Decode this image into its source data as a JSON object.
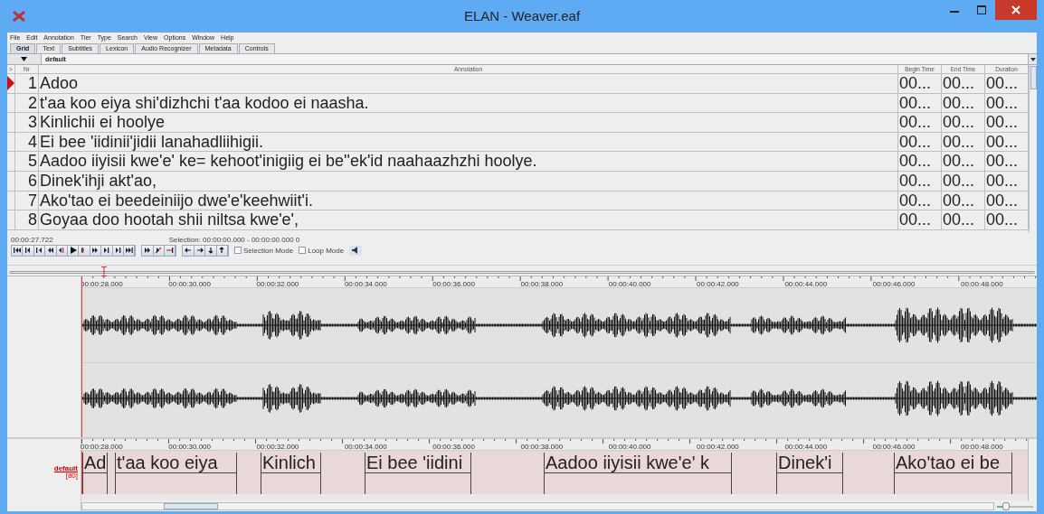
{
  "window": {
    "title": "ELAN - Weaver.eaf"
  },
  "menu": [
    "File",
    "Edit",
    "Annotation",
    "Tier",
    "Type",
    "Search",
    "View",
    "Options",
    "Window",
    "Help"
  ],
  "tabs": [
    {
      "label": "Grid",
      "selected": true
    },
    {
      "label": "Text",
      "selected": false
    },
    {
      "label": "Subtitles",
      "selected": false
    },
    {
      "label": "Lexicon",
      "selected": false
    },
    {
      "label": "Audio Recognizer",
      "selected": false
    },
    {
      "label": "Metadata",
      "selected": false
    },
    {
      "label": "Controls",
      "selected": false
    }
  ],
  "tier_selector": {
    "value": "default"
  },
  "table": {
    "columns": [
      ">",
      "Nr",
      "Annotation",
      "Begin Time",
      "End Time",
      "Duration"
    ],
    "rows": [
      {
        "nr": "1",
        "annotation": "Adoo",
        "begin": "00...",
        "end": "00...",
        "duration": "00...",
        "current": true
      },
      {
        "nr": "2",
        "annotation": "t'aa koo eiya shi'dizhchi t'aa kodoo ei naasha.",
        "begin": "00...",
        "end": "00...",
        "duration": "00...",
        "current": false
      },
      {
        "nr": "3",
        "annotation": "Kinlichii ei hoolye",
        "begin": "00...",
        "end": "00...",
        "duration": "00...",
        "current": false
      },
      {
        "nr": "4",
        "annotation": "Ei bee 'iidinii'jidii lanahadliihigii.",
        "begin": "00...",
        "end": "00...",
        "duration": "00...",
        "current": false
      },
      {
        "nr": "5",
        "annotation": "Aadoo iiyisii kwe'e' ke= kehoot'inigiig ei be''ek'id naahaazhzhi hoolye.",
        "begin": "00...",
        "end": "00...",
        "duration": "00...",
        "current": false
      },
      {
        "nr": "6",
        "annotation": "Dinek'ihji akt'ao,",
        "begin": "00...",
        "end": "00...",
        "duration": "00...",
        "current": false
      },
      {
        "nr": "7",
        "annotation": "Ako'tao ei beedeiniijo dwe'e'keehwiit'i.",
        "begin": "00...",
        "end": "00...",
        "duration": "00...",
        "current": false
      },
      {
        "nr": "8",
        "annotation": "Goyaa doo hootah shii niltsa kwe'e',",
        "begin": "00...",
        "end": "00...",
        "duration": "00...",
        "current": false
      }
    ]
  },
  "media": {
    "time": "00:00:27.722",
    "selection": "Selection: 00:00:00.000 - 00:00:00.000  0",
    "options": [
      {
        "label": "Selection Mode",
        "checked": false
      },
      {
        "label": "Loop Mode",
        "checked": false
      }
    ]
  },
  "waveform": {
    "ruler": [
      "00:00:28.000",
      "00:00:30.000",
      "00:00:32.000",
      "00:00:34.000",
      "00:00:36.000",
      "00:00:38.000",
      "00:00:40.000",
      "00:00:42.000",
      "00:00:44.000",
      "00:00:46.000",
      "00:00:48.000"
    ]
  },
  "tier_view": {
    "ruler": [
      "00:00:28.000",
      "00:00:30.000",
      "00:00:32.000",
      "00:00:34.000",
      "00:00:36.000",
      "00:00:38.000",
      "00:00:40.000",
      "00:00:42.000",
      "00:00:44.000",
      "00:00:46.000",
      "00:00:48.000"
    ],
    "tier": {
      "name": "default",
      "count": "[80]"
    },
    "annotations": [
      {
        "text": "Ad"
      },
      {
        "text": "t'aa koo eiya"
      },
      {
        "text": "Kinlich"
      },
      {
        "text": "Ei bee 'iidini"
      },
      {
        "text": "Aadoo iiyisii kwe'e' k"
      },
      {
        "text": "Dinek'i"
      },
      {
        "text": "Ako'tao ei be"
      }
    ]
  },
  "zoom_slider": {
    "level": 0.25
  }
}
